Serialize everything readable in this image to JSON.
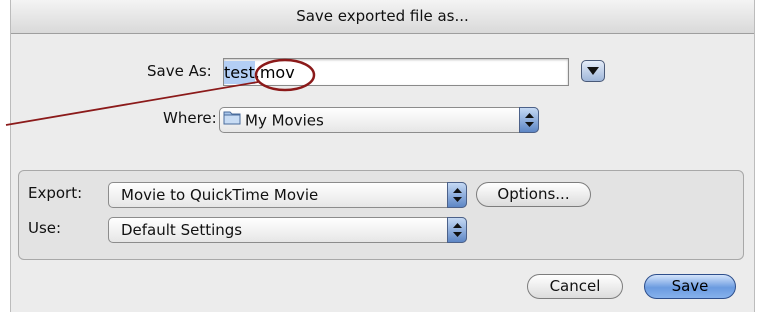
{
  "dialog": {
    "title": "Save exported file as...",
    "save_as_label": "Save As:",
    "filename": {
      "selected": "test",
      "rest": ".mov"
    },
    "where_label": "Where:",
    "where_value": "My Movies",
    "export_label": "Export:",
    "export_value": "Movie to QuickTime Movie",
    "options_label": "Options...",
    "use_label": "Use:",
    "use_value": "Default Settings",
    "cancel_label": "Cancel",
    "save_label": "Save"
  },
  "icons": [
    "disclosure-triangle-icon",
    "folder-icon",
    "popup-arrows-icon"
  ],
  "colors": {
    "accent": "#6b9be0",
    "annotation": "#8b1a1a",
    "selection": "#b3cef4"
  }
}
